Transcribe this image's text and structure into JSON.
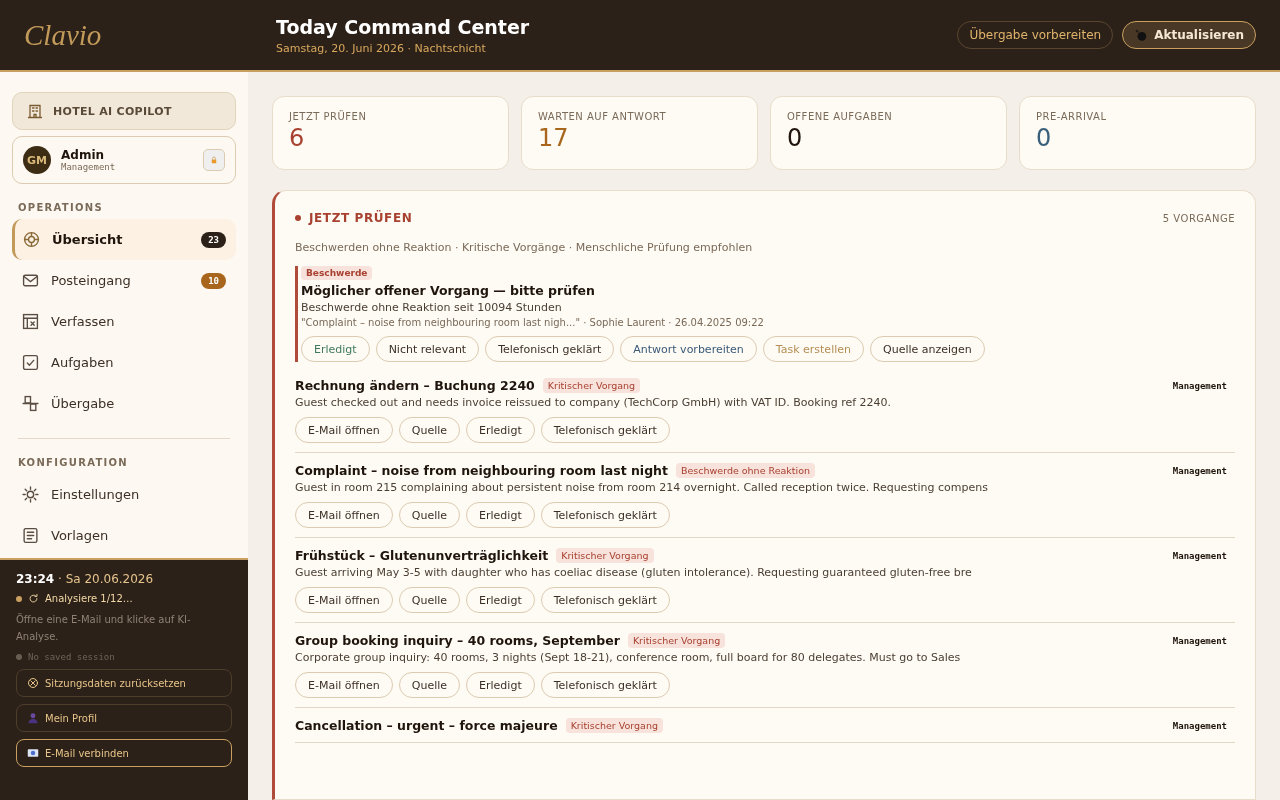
{
  "header": {
    "logo": "Clavio",
    "title": "Today Command Center",
    "subtitle": "Samstag, 20. Juni 2026 · Nachtschicht",
    "buttons": [
      {
        "label": "Übergabe vorbereiten",
        "kind": "plain"
      },
      {
        "label": "Aktualisieren",
        "kind": "primary"
      }
    ]
  },
  "sidebar": {
    "app_button": "HOTEL AI COPILOT",
    "user": {
      "initials": "GM",
      "name": "Admin",
      "role": "Management",
      "locked": true
    },
    "sections": [
      {
        "title": "OPERATIONS",
        "items": [
          {
            "kind": "target",
            "label": "Übersicht",
            "badge": "23",
            "color": "#2c2118",
            "selected": true
          },
          {
            "kind": "mail",
            "label": "Posteingang",
            "badge": "10",
            "color": "#a8661c",
            "selected": false
          },
          {
            "kind": "compose",
            "label": "Verfassen",
            "selected": false
          },
          {
            "kind": "check",
            "label": "Aufgaben",
            "selected": false
          },
          {
            "kind": "handover",
            "label": "Übergabe",
            "selected": false
          }
        ]
      },
      {
        "title": "KONFIGURATION",
        "items": [
          {
            "kind": "sun",
            "label": "Einstellungen",
            "selected": false
          },
          {
            "kind": "doc",
            "label": "Vorlagen",
            "selected": false
          }
        ]
      }
    ],
    "footer": {
      "time": "23:24",
      "date": "· Sa 20.06.2026",
      "status": "Analysiere 1/12…",
      "hint": "Öffne eine E-Mail und klicke auf KI-Analyse.",
      "session": "No saved session",
      "buttons": [
        {
          "kind": "reset",
          "label": "Sitzungsdaten zurücksetzen",
          "highlighted": false
        },
        {
          "kind": "person",
          "label": "Mein Profil",
          "highlighted": false
        },
        {
          "kind": "mail",
          "label": "E-Mail verbinden",
          "highlighted": true
        }
      ]
    }
  },
  "stats": [
    {
      "label": "JETZT PRÜFEN",
      "value": "6",
      "color": "#a8412f"
    },
    {
      "label": "WARTEN AUF ANTWORT",
      "value": "17",
      "color": "#a8661c"
    },
    {
      "label": "OFFENE AUFGABEN",
      "value": "0",
      "color": "#1f150c"
    },
    {
      "label": "PRE-ARRIVAL",
      "value": "0",
      "color": "#3a5f7a"
    }
  ],
  "panel": {
    "title": "JETZT PRÜFEN",
    "count": "5 VORGANGE",
    "subtitle": "Beschwerden ohne Reaktion · Kritische Vorgänge · Menschliche Prüfung empfohlen",
    "alert": {
      "tag": "Beschwerde",
      "title": "Möglicher offener Vorgang — bitte prüfen",
      "text": "Beschwerde ohne Reaktion seit 10094 Stunden",
      "meta": "\"Complaint – noise from neighbouring room last nigh...\" · Sophie Laurent · 26.04.2025 09:22",
      "actions": [
        {
          "label": "Erledigt",
          "kind": "green"
        },
        {
          "label": "Nicht relevant",
          "kind": "plain"
        },
        {
          "label": "Telefonisch geklärt",
          "kind": "plain"
        },
        {
          "label": "Antwort vorbereiten",
          "kind": "blue"
        },
        {
          "label": "Task erstellen",
          "kind": "gold"
        },
        {
          "label": "Quelle anzeigen",
          "kind": "plain"
        }
      ]
    },
    "items": [
      {
        "title": "Rechnung ändern – Buchung 2240",
        "tag": "Kritischer Vorgang",
        "owner": "Management",
        "text": "Guest checked out and needs invoice reissued to company (TechCorp GmbH) with VAT ID. Booking ref 2240.",
        "actions": [
          "E-Mail öffnen",
          "Quelle",
          "Erledigt",
          "Telefonisch geklärt"
        ]
      },
      {
        "title": "Complaint – noise from neighbouring room last night",
        "tag": "Beschwerde ohne Reaktion",
        "owner": "Management",
        "text": "Guest in room 215 complaining about persistent noise from room 214 overnight. Called reception twice. Requesting compens",
        "actions": [
          "E-Mail öffnen",
          "Quelle",
          "Erledigt",
          "Telefonisch geklärt"
        ]
      },
      {
        "title": "Frühstück – Glutenunverträglichkeit",
        "tag": "Kritischer Vorgang",
        "owner": "Management",
        "text": "Guest arriving May 3-5 with daughter who has coeliac disease (gluten intolerance). Requesting guaranteed gluten-free bre",
        "actions": [
          "E-Mail öffnen",
          "Quelle",
          "Erledigt",
          "Telefonisch geklärt"
        ]
      },
      {
        "title": "Group booking inquiry – 40 rooms, September",
        "tag": "Kritischer Vorgang",
        "owner": "Management",
        "text": "Corporate group inquiry: 40 rooms, 3 nights (Sept 18-21), conference room, full board for 80 delegates. Must go to Sales",
        "actions": [
          "E-Mail öffnen",
          "Quelle",
          "Erledigt",
          "Telefonisch geklärt"
        ]
      },
      {
        "title": "Cancellation – urgent – force majeure",
        "tag": "Kritischer Vorgang",
        "owner": "Management"
      }
    ]
  }
}
